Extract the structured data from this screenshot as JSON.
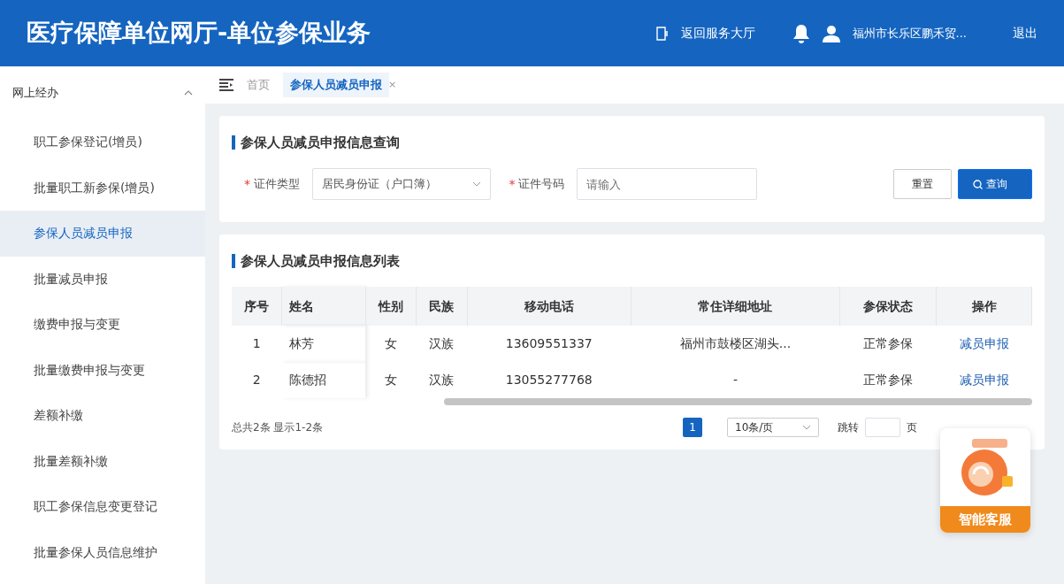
{
  "header": {
    "title": "医疗保障单位网厅-单位参保业务",
    "back_link": "返回服务大厅",
    "user": "福州市长乐区鹏禾贸...",
    "logout": "退出"
  },
  "sidebar": {
    "group": {
      "label": "网上经办",
      "expanded": true
    },
    "items": [
      {
        "label": "职工参保登记(增员)",
        "selected": false
      },
      {
        "label": "批量职工新参保(增员)",
        "selected": false
      },
      {
        "label": "参保人员减员申报",
        "selected": true
      },
      {
        "label": "批量减员申报",
        "selected": false
      },
      {
        "label": "缴费申报与变更",
        "selected": false
      },
      {
        "label": "批量缴费申报与变更",
        "selected": false
      },
      {
        "label": "差额补缴",
        "selected": false
      },
      {
        "label": "批量差额补缴",
        "selected": false
      },
      {
        "label": "职工参保信息变更登记",
        "selected": false
      },
      {
        "label": "批量参保人员信息维护",
        "selected": false
      }
    ]
  },
  "breadcrumb_tabs": [
    {
      "label": "首页",
      "selected": false
    },
    {
      "label": "参保人员减员申报",
      "selected": true,
      "close_mark": "×"
    }
  ],
  "query": {
    "title": "参保人员减员申报信息查询",
    "fields": [
      {
        "kind": "select",
        "label": "证件类型",
        "required_mark": "*",
        "value": "居民身份证（户口簿）"
      },
      {
        "kind": "input",
        "label": "证件号码",
        "required_mark": "*",
        "placeholder": "请输入"
      }
    ],
    "buttons": [
      {
        "label": "重置",
        "kind": "default"
      },
      {
        "label": "查询",
        "kind": "primary"
      }
    ]
  },
  "list": {
    "title": "参保人员减员申报信息列表",
    "columns": [
      "序号",
      "姓名",
      "性别",
      "民族",
      "移动电话",
      "常住详细地址",
      "参保状态",
      "操作"
    ],
    "rows": [
      [
        "1",
        "林芳",
        "女",
        "汉族",
        "13609551337",
        "福州市鼓楼区湖头...",
        "正常参保",
        "减员申报"
      ],
      [
        "2",
        "陈德招",
        "女",
        "汉族",
        "13055277768",
        "-",
        "正常参保",
        "减员申报"
      ]
    ],
    "summary": "总共2条 显示1-2条",
    "pagination": {
      "pages": [
        {
          "label": "1",
          "selected": true
        }
      ],
      "page_size": "10条/页",
      "jump_label": "跳转",
      "page_unit": "页"
    }
  },
  "chat_widget": {
    "label": "智能客服"
  }
}
